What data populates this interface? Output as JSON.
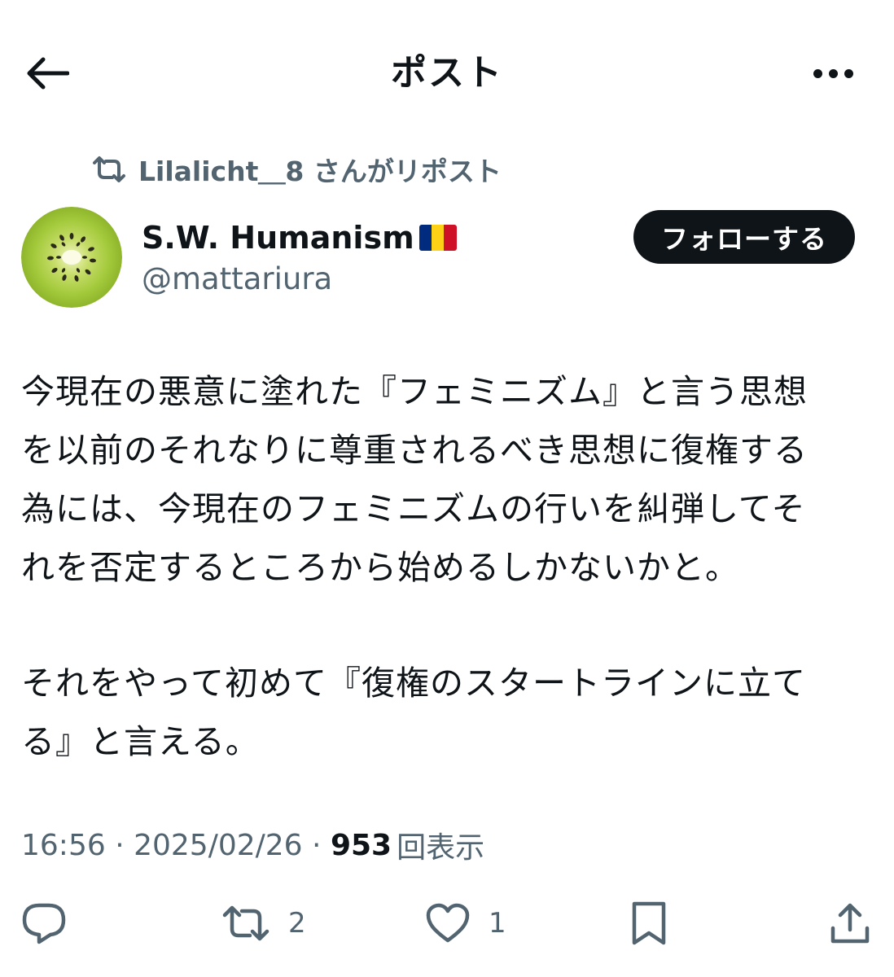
{
  "header": {
    "title": "ポスト",
    "back_icon": "arrow-left-icon",
    "more_icon": "more-horizontal-icon"
  },
  "repost": {
    "icon": "repost-icon",
    "text": "Lilalicht＿8 さんがリポスト"
  },
  "author": {
    "name": "S.W. Humanism",
    "flag_icon": "romania-flag-icon",
    "handle": "@mattariura",
    "avatar_icon": "kiwi-avatar"
  },
  "follow_button": {
    "label": "フォローする"
  },
  "post": {
    "paragraph_1": "今現在の悪意に塗れた『フェミニズム』と言う思想\nを以前のそれなりに尊重されるべき思想に復権する\n為には、今現在のフェミニズムの行いを糾弾してそ\nれを否定するところから始めるしかないかと。",
    "paragraph_2": "それをやって初めて『復権のスタートラインに立て\nる』と言える。"
  },
  "meta": {
    "time": "16:56",
    "separator_1": " · ",
    "date": "2025/02/26",
    "separator_2": " · ",
    "views": "953",
    "views_label": "回表示"
  },
  "actions": {
    "reply": {
      "icon": "reply-icon",
      "count": ""
    },
    "repost": {
      "icon": "repost-icon",
      "count": "2"
    },
    "like": {
      "icon": "heart-icon",
      "count": "1"
    },
    "bookmark": {
      "icon": "bookmark-icon",
      "count": ""
    },
    "share": {
      "icon": "share-icon",
      "count": ""
    }
  },
  "colors": {
    "text_primary": "#0f1419",
    "text_secondary": "#536471",
    "follow_bg": "#0f1419",
    "kiwi_green": "#9cc530"
  }
}
